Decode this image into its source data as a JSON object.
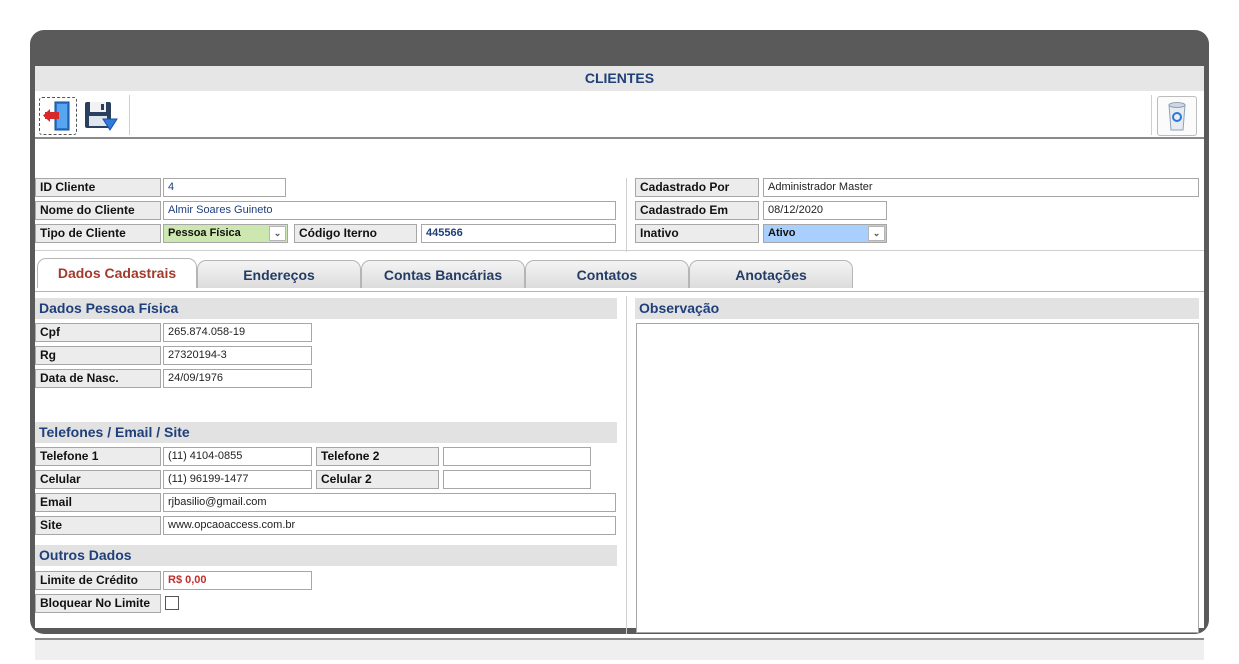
{
  "window": {
    "title": "CLIENTES"
  },
  "toolbar": {
    "exit_icon": "exit-door-icon",
    "save_icon": "save-disk-icon",
    "recycle_icon": "recycle-bin-icon"
  },
  "header": {
    "id_label": "ID Cliente",
    "id_value": "4",
    "name_label": "Nome do Cliente",
    "name_value": "Almir Soares Guineto",
    "type_label": "Tipo de Cliente",
    "type_value": "Pessoa Física",
    "code_label": "Código Iterno",
    "code_value": "445566",
    "created_by_label": "Cadastrado Por",
    "created_by_value": "Administrador Master",
    "created_at_label": "Cadastrado Em",
    "created_at_value": "08/12/2020",
    "inactive_label": "Inativo",
    "inactive_value": "Ativo"
  },
  "tabs": [
    {
      "label": "Dados Cadastrais"
    },
    {
      "label": "Endereços"
    },
    {
      "label": "Contas Bancárias"
    },
    {
      "label": "Contatos"
    },
    {
      "label": "Anotações"
    }
  ],
  "pf": {
    "title": "Dados Pessoa Física",
    "cpf_label": "Cpf",
    "cpf_value": "265.874.058-19",
    "rg_label": "Rg",
    "rg_value": "27320194-3",
    "birth_label": "Data de Nasc.",
    "birth_value": "24/09/1976"
  },
  "contact": {
    "title": "Telefones / Email / Site",
    "phone1_label": "Telefone 1",
    "phone1_value": "(11) 4104-0855",
    "phone2_label": "Telefone 2",
    "phone2_value": "",
    "cell1_label": "Celular",
    "cell1_value": "(11) 96199-1477",
    "cell2_label": "Celular 2",
    "cell2_value": "",
    "email_label": "Email",
    "email_value": "rjbasilio@gmail.com",
    "site_label": "Site",
    "site_value": "www.opcaoaccess.com.br"
  },
  "other": {
    "title": "Outros Dados",
    "credit_label": "Limite de Crédito",
    "credit_value": "R$ 0,00",
    "block_label": "Bloquear No Limite"
  },
  "obs": {
    "title": "Observação",
    "text": ""
  },
  "colors": {
    "accent": "#1f3f7a",
    "active_tab": "#a33a2e",
    "type_combo": "#cde7b0",
    "status_combo": "#a9cfff"
  }
}
